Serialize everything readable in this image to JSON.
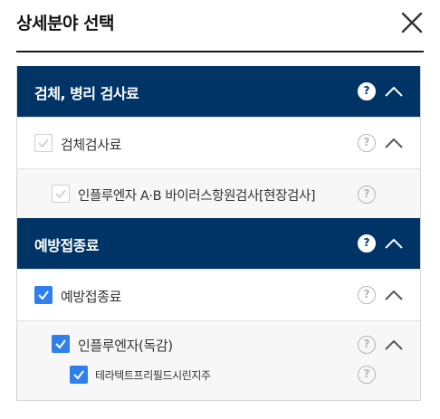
{
  "dialog": {
    "title": "상세분야 선택",
    "close_icon": "close-icon"
  },
  "sections": [
    {
      "title": "검체, 병리 검사료",
      "help_glyph": "?",
      "items": [
        {
          "label": "검체검사료",
          "checked": false,
          "help_glyph": "?"
        },
        {
          "label": "인플루엔자 A·B 바이러스항원검사[현장검사]",
          "checked": false,
          "help_glyph": "?"
        }
      ]
    },
    {
      "title": "예방접종료",
      "help_glyph": "?",
      "items": [
        {
          "label": "예방접종료",
          "checked": true,
          "help_glyph": "?"
        },
        {
          "label": "인플루엔자(독감)",
          "checked": true,
          "help_glyph": "?"
        },
        {
          "label": "테라텍트프리필드시린지주",
          "checked": true,
          "help_glyph": "?"
        }
      ]
    }
  ],
  "colors": {
    "section_header_bg": "#003366",
    "checkbox_checked": "#2f80ed"
  }
}
